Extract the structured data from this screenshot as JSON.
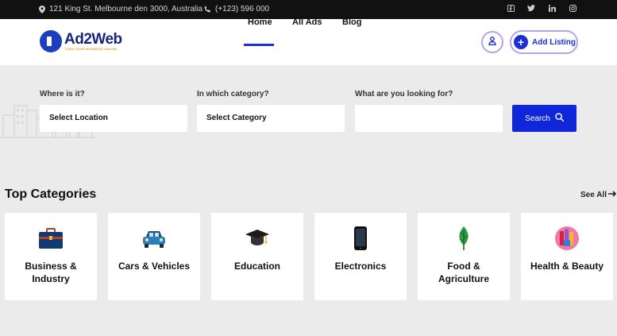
{
  "topbar": {
    "address": "121 King St. Melbourne den 3000, Australia",
    "phone": "(+123) 596 000",
    "social": [
      "facebook-icon",
      "twitter-icon",
      "linkedin-icon",
      "instagram-icon"
    ]
  },
  "navbar": {
    "logo_name": "Ad2Web",
    "logo_tag": "TURN YOUR BUSINESS ONLINE",
    "links": [
      "Home",
      "All Ads",
      "Blog"
    ],
    "active_link": "Home",
    "add_listing": "Add Listing"
  },
  "search": {
    "location_label": "Where is it?",
    "location_value": "Select Location",
    "category_label": "In which category?",
    "category_value": "Select Category",
    "keyword_label": "What are you looking for?",
    "keyword_value": "",
    "button": "Search"
  },
  "categories": {
    "title": "Top Categories",
    "see_all": "See All",
    "items": [
      {
        "label": "Business & Industry",
        "icon": "briefcase-icon"
      },
      {
        "label": "Cars & Vehicles",
        "icon": "car-icon"
      },
      {
        "label": "Education",
        "icon": "graduation-cap-icon"
      },
      {
        "label": "Electronics",
        "icon": "smartphone-icon"
      },
      {
        "label": "Food & Agriculture",
        "icon": "leaf-icon"
      },
      {
        "label": "Health & Beauty",
        "icon": "cosmetics-icon"
      }
    ]
  },
  "colors": {
    "accent": "#1026d9",
    "topbar_bg": "#111111",
    "page_bg": "#ebebeb"
  }
}
